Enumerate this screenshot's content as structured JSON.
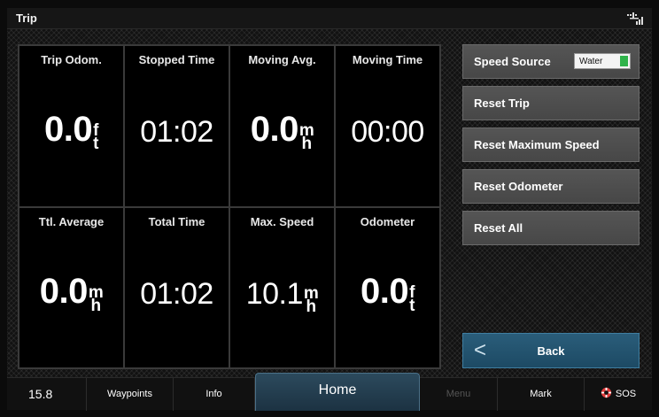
{
  "title_bar": {
    "title": "Trip",
    "signal_icon": "signal-icon"
  },
  "data_cells": [
    {
      "label": "Trip Odom.",
      "value": "0.0",
      "unit_top": "f",
      "unit_bottom": "t"
    },
    {
      "label": "Stopped Time",
      "value": "01:02",
      "unit_top": "",
      "unit_bottom": ""
    },
    {
      "label": "Moving Avg.",
      "value": "0.0",
      "unit_top": "m",
      "unit_bottom": "h"
    },
    {
      "label": "Moving Time",
      "value": "00:00",
      "unit_top": "",
      "unit_bottom": ""
    },
    {
      "label": "Ttl. Average",
      "value": "0.0",
      "unit_top": "m",
      "unit_bottom": "h"
    },
    {
      "label": "Total Time",
      "value": "01:02",
      "unit_top": "",
      "unit_bottom": ""
    },
    {
      "label": "Max. Speed",
      "value": "10.1",
      "unit_top": "m",
      "unit_bottom": "h"
    },
    {
      "label": "Odometer",
      "value": "0.0",
      "unit_top": "f",
      "unit_bottom": "t"
    }
  ],
  "side_menu": {
    "speed_source": {
      "label": "Speed Source",
      "toggle_value": "Water",
      "toggle_color": "#2fb34a"
    },
    "reset_trip": "Reset Trip",
    "reset_max_speed": "Reset Maximum Speed",
    "reset_odometer": "Reset Odometer",
    "reset_all": "Reset All",
    "back": "Back",
    "back_icon": "chevron-left-icon"
  },
  "bottom_bar": {
    "speed": "15.8",
    "waypoints": "Waypoints",
    "info": "Info",
    "home": "Home",
    "menu": "Menu",
    "mark": "Mark",
    "sos": "SOS",
    "sos_icon": "lifebuoy-icon"
  },
  "colors": {
    "accent": "#1d4a64",
    "button": "#4d4d4d",
    "background": "#000000"
  }
}
